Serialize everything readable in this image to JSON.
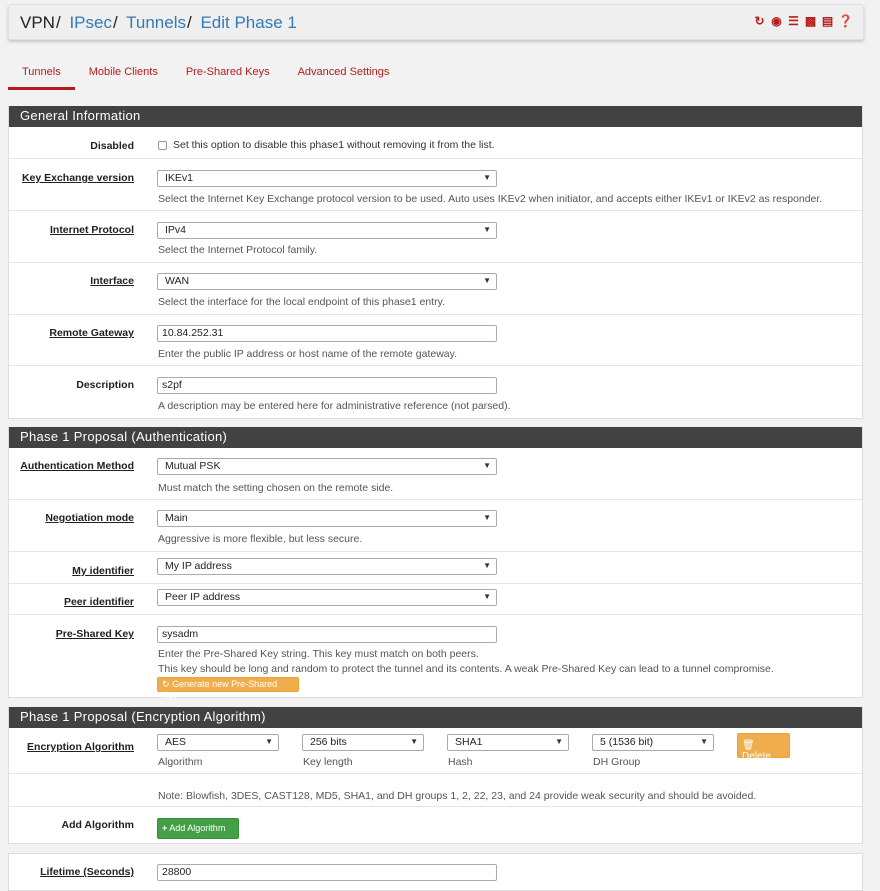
{
  "breadcrumb": {
    "vpn": "VPN",
    "ipsec": "IPsec",
    "tunnels": "Tunnels",
    "current": "Edit Phase 1",
    "sep": "/"
  },
  "header_icons": [
    "reload-icon",
    "stop-icon",
    "sliders-icon",
    "chart-icon",
    "list-icon",
    "help-icon"
  ],
  "tabs": [
    {
      "label": "Tunnels",
      "active": true
    },
    {
      "label": "Mobile Clients"
    },
    {
      "label": "Pre-Shared Keys"
    },
    {
      "label": "Advanced Settings"
    }
  ],
  "general": {
    "title": "General Information",
    "disabled": {
      "label": "Disabled",
      "help": "Set this option to disable this phase1 without removing it from the list."
    },
    "key_exchange": {
      "label": "Key Exchange version",
      "value": "IKEv1",
      "help": "Select the Internet Key Exchange protocol version to be used. Auto uses IKEv2 when initiator, and accepts either IKEv1 or IKEv2 as responder."
    },
    "internet_protocol": {
      "label": "Internet Protocol",
      "value": "IPv4",
      "help": "Select the Internet Protocol family."
    },
    "interface": {
      "label": "Interface",
      "value": "WAN",
      "help": "Select the interface for the local endpoint of this phase1 entry."
    },
    "remote_gateway": {
      "label": "Remote Gateway",
      "value": "10.84.252.31",
      "help": "Enter the public IP address or host name of the remote gateway."
    },
    "description": {
      "label": "Description",
      "value": "s2pf",
      "help": "A description may be entered here for administrative reference (not parsed)."
    }
  },
  "auth": {
    "title": "Phase 1 Proposal (Authentication)",
    "method": {
      "label": "Authentication Method",
      "value": "Mutual PSK",
      "help": "Must match the setting chosen on the remote side."
    },
    "negotiation": {
      "label": "Negotiation mode",
      "value": "Main",
      "help": "Aggressive is more flexible, but less secure."
    },
    "my_id": {
      "label": "My identifier",
      "value": "My IP address"
    },
    "peer_id": {
      "label": "Peer identifier",
      "value": "Peer IP address"
    },
    "psk": {
      "label": "Pre-Shared Key",
      "value": "sysadm",
      "help1": "Enter the Pre-Shared Key string. This key must match on both peers.",
      "help2": "This key should be long and random to protect the tunnel and its contents. A weak Pre-Shared Key can lead to a tunnel compromise.",
      "gen_button": "Generate new Pre-Shared Key"
    }
  },
  "enc": {
    "title": "Phase 1 Proposal (Encryption Algorithm)",
    "label": "Encryption Algorithm",
    "algorithm": {
      "value": "AES",
      "sub": "Algorithm"
    },
    "key_length": {
      "value": "256 bits",
      "sub": "Key length"
    },
    "hash": {
      "value": "SHA1",
      "sub": "Hash"
    },
    "dh": {
      "value": "5 (1536 bit)",
      "sub": "DH Group"
    },
    "delete_button": "Delete",
    "note": "Note: Blowfish, 3DES, CAST128, MD5, SHA1, and DH groups 1, 2, 22, 23, and 24 provide weak security and should be avoided.",
    "add_label": "Add Algorithm",
    "add_button": "Add Algorithm"
  },
  "lifetime": {
    "label": "Lifetime (Seconds)",
    "value": "28800"
  }
}
